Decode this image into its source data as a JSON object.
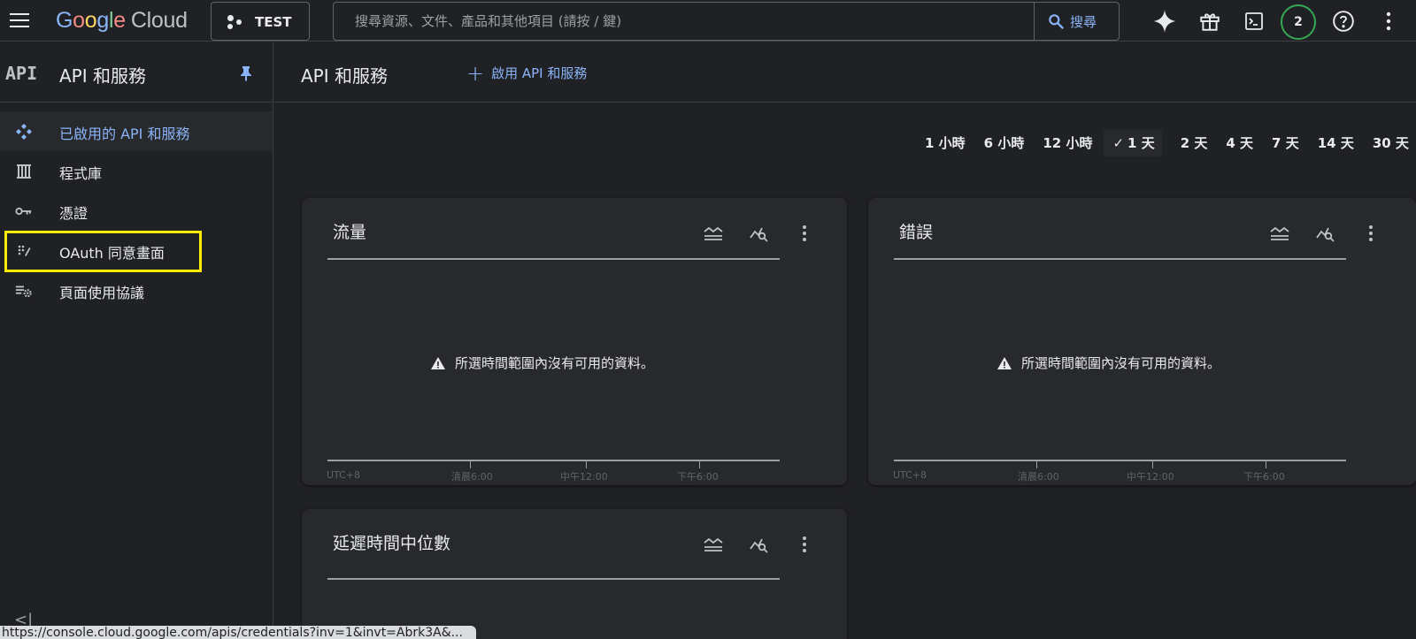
{
  "header": {
    "logo": {
      "g1": "G",
      "o1": "o",
      "o2": "o",
      "g2": "g",
      "l": "l",
      "e": "e",
      "cloud": "Cloud"
    },
    "project": "TEST",
    "search_placeholder": "搜尋資源、文件、產品和其他項目 (請按 / 鍵)",
    "search_button": "搜尋",
    "notification_count": "2"
  },
  "sidebar": {
    "logo_text": "API",
    "title": "API 和服務",
    "items": [
      {
        "label": "已啟用的 API 和服務",
        "icon": "enabled-apis-icon",
        "active": true
      },
      {
        "label": "程式庫",
        "icon": "library-icon"
      },
      {
        "label": "憑證",
        "icon": "key-icon"
      },
      {
        "label": "OAuth 同意畫面",
        "icon": "oauth-consent-icon"
      },
      {
        "label": "頁面使用協議",
        "icon": "page-agreements-icon"
      }
    ],
    "collapse_glyph": "<|"
  },
  "status_bar": {
    "url": "https://console.cloud.google.com/apis/credentials?inv=1&invt=Abrk3A&..."
  },
  "main": {
    "title": "API 和服務",
    "enable_button": "啟用 API 和服務",
    "time_ranges": [
      "1 小時",
      "6 小時",
      "12 小時",
      "1 天",
      "2 天",
      "4 天",
      "7 天",
      "14 天",
      "30 天"
    ],
    "selected_range": "1 天",
    "cards": [
      {
        "title": "流量",
        "message": "所選時間範圍內沒有可用的資料。",
        "axis_labels": [
          "UTC+8",
          "清晨6:00",
          "中午12:00",
          "下午6:00"
        ]
      },
      {
        "title": "錯誤",
        "message": "所選時間範圍內沒有可用的資料。",
        "axis_labels": [
          "UTC+8",
          "清晨6:00",
          "中午12:00",
          "下午6:00"
        ]
      },
      {
        "title": "延遲時間中位數"
      }
    ]
  },
  "colors": {
    "accent": "#8ab4f8",
    "highlight": "#ffeb00",
    "background": "#202124",
    "card": "#28292c"
  }
}
